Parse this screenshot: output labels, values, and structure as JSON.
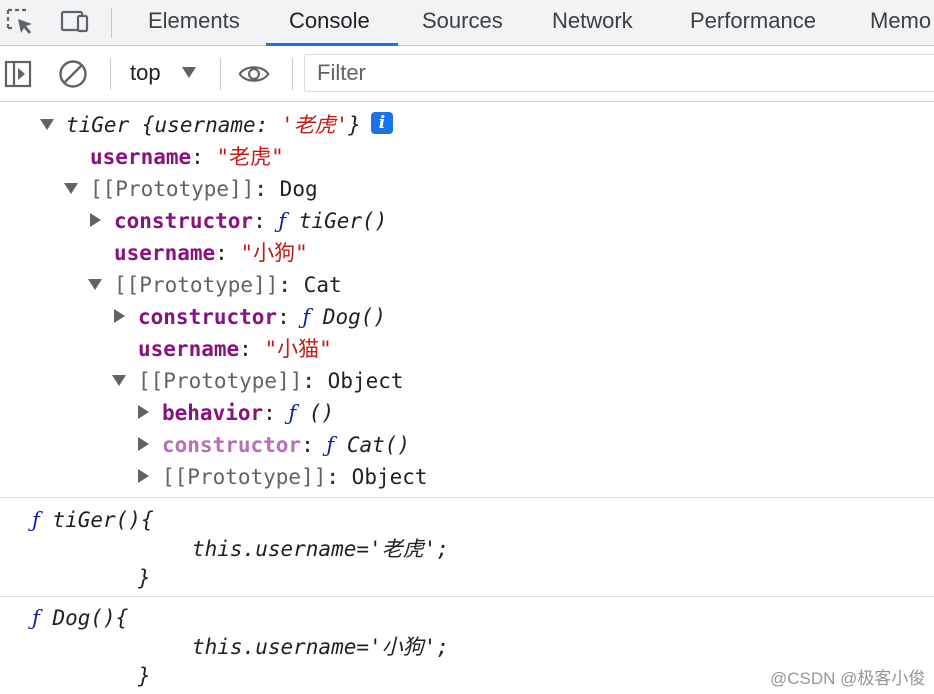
{
  "tabs": [
    "Elements",
    "Console",
    "Sources",
    "Network",
    "Performance",
    "Memo"
  ],
  "toolbar": {
    "context": "top",
    "filter_placeholder": "Filter"
  },
  "tree": {
    "root_name": "tiGer",
    "root_preview_open": "{",
    "root_preview_key": "username",
    "root_preview_sep": ": ",
    "root_preview_val": "'老虎'",
    "root_preview_close": "}",
    "info_glyph": "i",
    "l1_key": "username",
    "l1_val": "\"老虎\"",
    "proto1": "[[Prototype]]",
    "proto1_type": "Dog",
    "l2_ctor_key": "constructor",
    "l2_ctor_f": "ƒ",
    "l2_ctor_val": "tiGer()",
    "l2_user_key": "username",
    "l2_user_val": "\"小狗\"",
    "proto2": "[[Prototype]]",
    "proto2_type": "Cat",
    "l3_ctor_key": "constructor",
    "l3_ctor_f": "ƒ",
    "l3_ctor_val": "Dog()",
    "l3_user_key": "username",
    "l3_user_val": "\"小猫\"",
    "proto3": "[[Prototype]]",
    "proto3_type": "Object",
    "l4_beh_key": "behavior",
    "l4_beh_f": "ƒ",
    "l4_beh_val": "()",
    "l4_ctor_key": "constructor",
    "l4_ctor_f": "ƒ",
    "l4_ctor_val": "Cat()",
    "l4_proto": "[[Prototype]]",
    "l4_proto_type": "Object",
    "colon": ": "
  },
  "outputs": [
    {
      "f": "ƒ",
      "head": "tiGer(){",
      "body_pre": "this.username=",
      "body_str": "'老虎'",
      "body_end": ";",
      "close": "}"
    },
    {
      "f": "ƒ",
      "head": "Dog(){",
      "body_pre": "this.username=",
      "body_str": "'小狗'",
      "body_end": ";",
      "close": "}"
    }
  ],
  "watermark": "@CSDN @极客小俊",
  "icons": [
    "inspect-element-icon",
    "device-toolbar-icon",
    "sidebar-toggle-icon",
    "clear-console-icon",
    "live-expression-eye-icon",
    "info-icon"
  ]
}
